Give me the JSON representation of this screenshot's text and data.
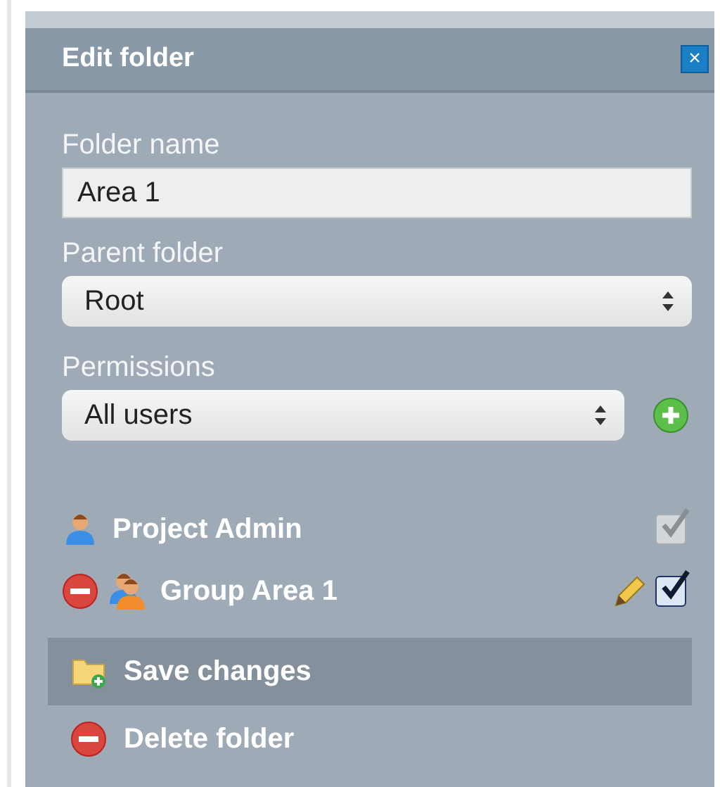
{
  "dialog": {
    "title": "Edit folder",
    "close_label": "×"
  },
  "folder_name": {
    "label": "Folder name",
    "value": "Area 1"
  },
  "parent_folder": {
    "label": "Parent folder",
    "value": "Root"
  },
  "permissions": {
    "label": "Permissions",
    "value": "All users",
    "entries": [
      {
        "name": "Project Admin",
        "kind": "user",
        "removable": false,
        "editable": false,
        "checked": true,
        "disabled": true
      },
      {
        "name": "Group Area 1",
        "kind": "group",
        "removable": true,
        "editable": true,
        "checked": true,
        "disabled": false
      }
    ]
  },
  "actions": [
    {
      "label": "Save changes",
      "kind": "save",
      "highlighted": true
    },
    {
      "label": "Delete folder",
      "kind": "delete",
      "highlighted": false
    }
  ]
}
